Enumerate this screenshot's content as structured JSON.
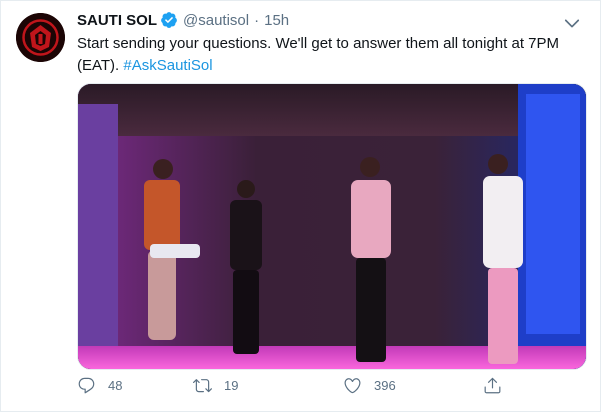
{
  "tweet": {
    "author_name": "SAUTI SOL",
    "handle": "@sautisol",
    "separator": "·",
    "time": "15h",
    "text": "Start sending your questions. We'll get to answer them all tonight at 7PM (EAT). ",
    "hashtag": "#AskSautiSol",
    "actions": {
      "replies": "48",
      "retweets": "19",
      "likes": "396"
    }
  },
  "colors": {
    "accent": "#1b95e0",
    "verified": "#1da1f2",
    "muted": "#5b7083",
    "avatar_red": "#c0151b"
  },
  "icons": {
    "verified": "verified-badge-icon",
    "caret": "chevron-down-icon",
    "reply": "reply-icon",
    "retweet": "retweet-icon",
    "like": "heart-icon",
    "share": "share-icon"
  }
}
